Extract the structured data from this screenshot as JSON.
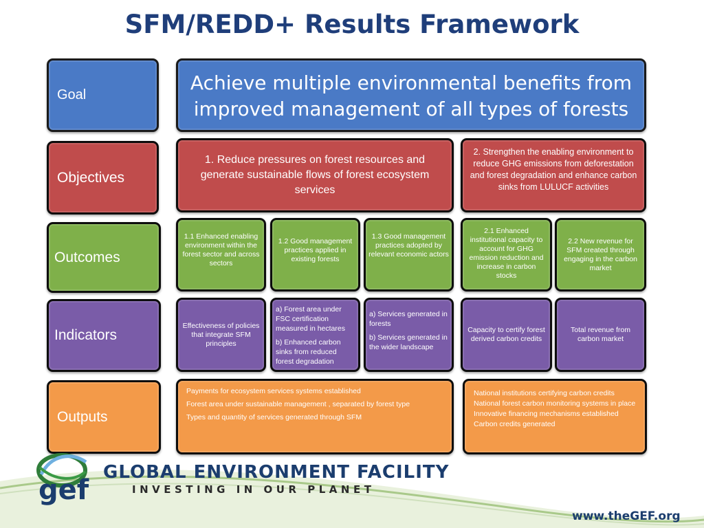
{
  "title": "SFM/REDD+ Results Framework",
  "rows": {
    "goal": "Goal",
    "objectives": "Objectives",
    "outcomes": "Outcomes",
    "indicators": "Indicators",
    "outputs": "Outputs"
  },
  "goal_text": "Achieve multiple environmental benefits from improved management of all types of forests",
  "objectives": {
    "o1": "1. Reduce pressures on forest resources and generate sustainable flows of forest ecosystem services",
    "o2": "2. Strengthen the enabling environment to reduce GHG  emissions from deforestation  and forest degradation and  enhance carbon sinks from  LULUCF activities"
  },
  "outcomes": {
    "o11": "1.1 Enhanced enabling environment within the forest sector and across sectors",
    "o12": "1.2 Good management practices applied in existing forests",
    "o13": "1.3 Good management practices adopted by relevant economic actors",
    "o21": "2.1 Enhanced institutional capacity to account for GHG emission reduction and increase in carbon stocks",
    "o22": "2.2 New revenue for SFM created through engaging in the carbon market"
  },
  "indicators": {
    "i11": "Effectiveness of policies that integrate SFM principles",
    "i12a": "a) Forest area under FSC certification measured in hectares",
    "i12b": "b) Enhanced carbon sinks from reduced forest degradation",
    "i13a": "a) Services generated in forests",
    "i13b": "b) Services generated in the wider landscape",
    "i21": "Capacity to certify forest derived carbon credits",
    "i22": "Total revenue from carbon market"
  },
  "outputs": {
    "left": [
      "Payments for ecosystem services systems established",
      "Forest area under sustainable management , separated by forest type",
      "Types  and quantity of services generated through SFM"
    ],
    "right": [
      "National institutions certifying carbon credits",
      "National forest carbon monitoring  systems in place",
      "Innovative financing mechanisms established",
      "Carbon credits generated"
    ]
  },
  "footer": {
    "logo_text": "gef",
    "org_name": "GLOBAL ENVIRONMENT FACILITY",
    "tagline": "INVESTING IN OUR PLANET",
    "url": "www.theGEF.org"
  },
  "colors": {
    "title": "#1f3e7a",
    "goal": "#4a7ac6",
    "objectives": "#c04c4c",
    "outcomes": "#7fb04a",
    "indicators": "#7a5ca8",
    "outputs": "#f39a49"
  }
}
